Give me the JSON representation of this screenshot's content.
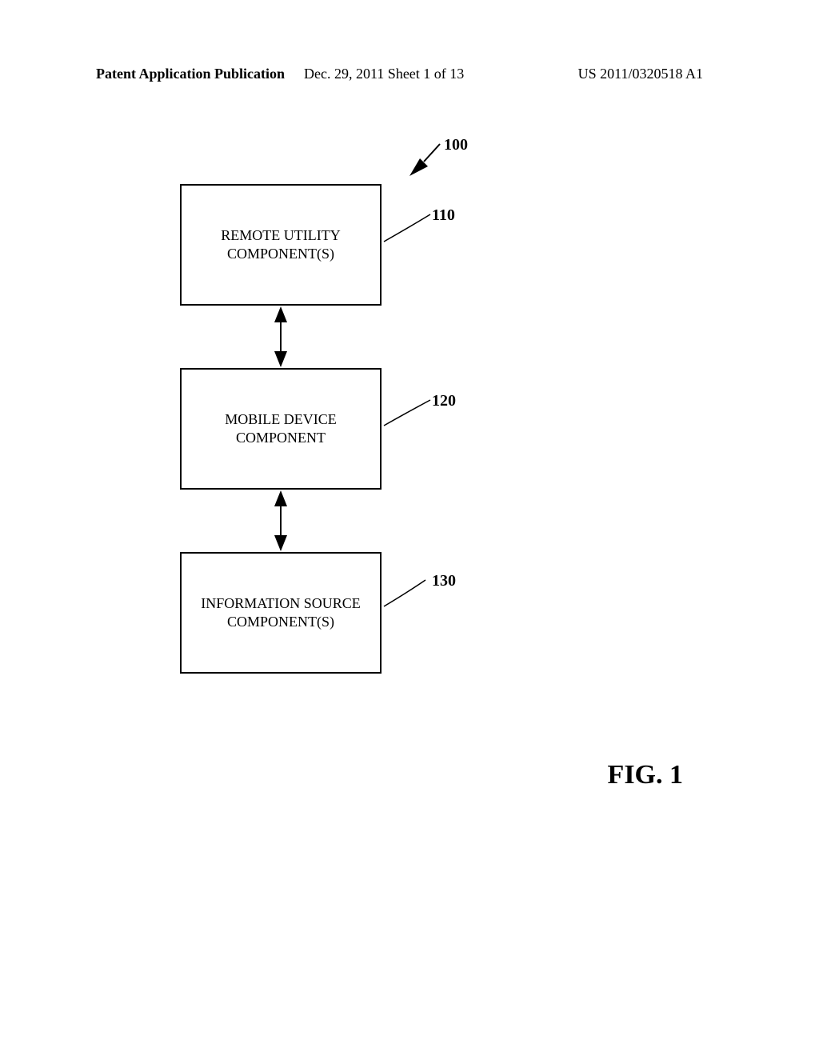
{
  "header": {
    "left": "Patent Application Publication",
    "center": "Dec. 29, 2011  Sheet 1 of 13",
    "right": "US 2011/0320518 A1"
  },
  "diagram": {
    "box110": "REMOTE UTILITY\nCOMPONENT(S)",
    "box120": "MOBILE DEVICE\nCOMPONENT",
    "box130": "INFORMATION SOURCE\nCOMPONENT(S)"
  },
  "labels": {
    "l100": "100",
    "l110": "110",
    "l120": "120",
    "l130": "130"
  },
  "figure": "FIG. 1"
}
